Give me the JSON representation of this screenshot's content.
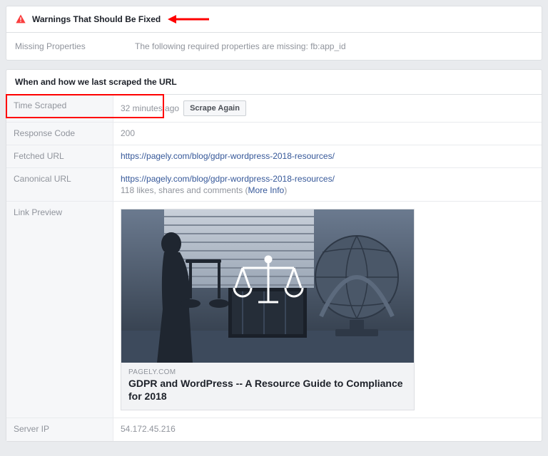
{
  "warnings": {
    "title": "Warnings That Should Be Fixed",
    "items": [
      {
        "label": "Missing Properties",
        "value": "The following required properties are missing: fb:app_id"
      }
    ]
  },
  "scrape": {
    "header": "When and how we last scraped the URL",
    "rows": {
      "time_scraped": {
        "label": "Time Scraped",
        "value": "32 minutes ago",
        "button": "Scrape Again"
      },
      "response_code": {
        "label": "Response Code",
        "value": "200"
      },
      "fetched_url": {
        "label": "Fetched URL",
        "value": "https://pagely.com/blog/gdpr-wordpress-2018-resources/"
      },
      "canonical_url": {
        "label": "Canonical URL",
        "value": "https://pagely.com/blog/gdpr-wordpress-2018-resources/",
        "meta_prefix": "118 likes, shares and comments (",
        "meta_link": "More Info",
        "meta_suffix": ")"
      },
      "link_preview": {
        "label": "Link Preview",
        "domain": "PAGELY.COM",
        "title": "GDPR and WordPress -- A Resource Guide to Compliance for 2018"
      },
      "server_ip": {
        "label": "Server IP",
        "value": "54.172.45.216"
      }
    }
  }
}
